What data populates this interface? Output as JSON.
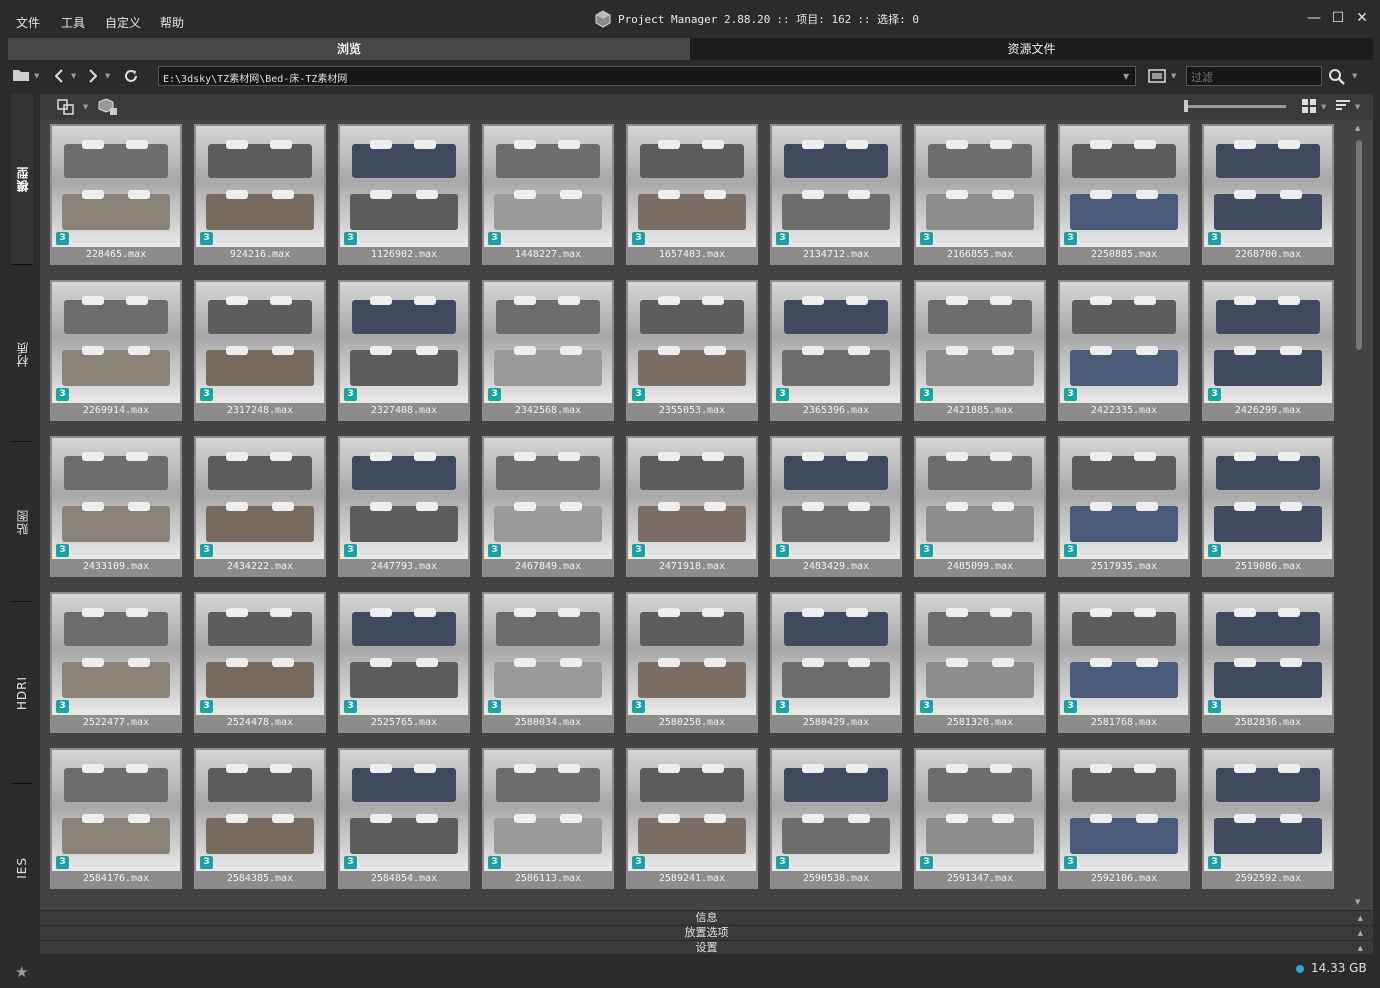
{
  "menu": {
    "file": "文件",
    "tools": "工具",
    "custom": "自定义",
    "help": "帮助"
  },
  "title": {
    "app": "Project Manager 2.88.20",
    "items": ":: 项目: 162",
    "selection": ":: 选择: 0"
  },
  "tabs": {
    "browse": "浏览",
    "assets": "资源文件"
  },
  "toolbar": {
    "path": "E:\\3dsky\\TZ素材网\\Bed-床-TZ素材网",
    "filter_placeholder": "过滤"
  },
  "sidebar": [
    "模型",
    "材质",
    "贴图",
    "HDRI",
    "IES"
  ],
  "files": [
    "228465.max",
    "924216.max",
    "1126902.max",
    "1448227.max",
    "1657403.max",
    "2134712.max",
    "2166855.max",
    "2250885.max",
    "2268700.max",
    "2269914.max",
    "2317248.max",
    "2327408.max",
    "2342568.max",
    "2355053.max",
    "2365396.max",
    "2421885.max",
    "2422335.max",
    "2426299.max",
    "2433109.max",
    "2434222.max",
    "2447793.max",
    "2467849.max",
    "2471918.max",
    "2483429.max",
    "2485099.max",
    "2517935.max",
    "2519086.max",
    "2522477.max",
    "2524478.max",
    "2525765.max",
    "2580034.max",
    "2580250.max",
    "2580429.max",
    "2581320.max",
    "2581768.max",
    "2582836.max",
    "2584176.max",
    "2584385.max",
    "2584854.max",
    "2586113.max",
    "2589241.max",
    "2590538.max",
    "2591347.max",
    "2592106.max",
    "2592592.max"
  ],
  "badge_label": "3",
  "bottom_panels": {
    "info": "信息",
    "placement": "放置选项",
    "settings": "设置"
  },
  "status": {
    "disk": "14.33 GB"
  },
  "colors": {
    "accent": "#1aa3a3",
    "disk_dot": "#2ba6e0"
  }
}
